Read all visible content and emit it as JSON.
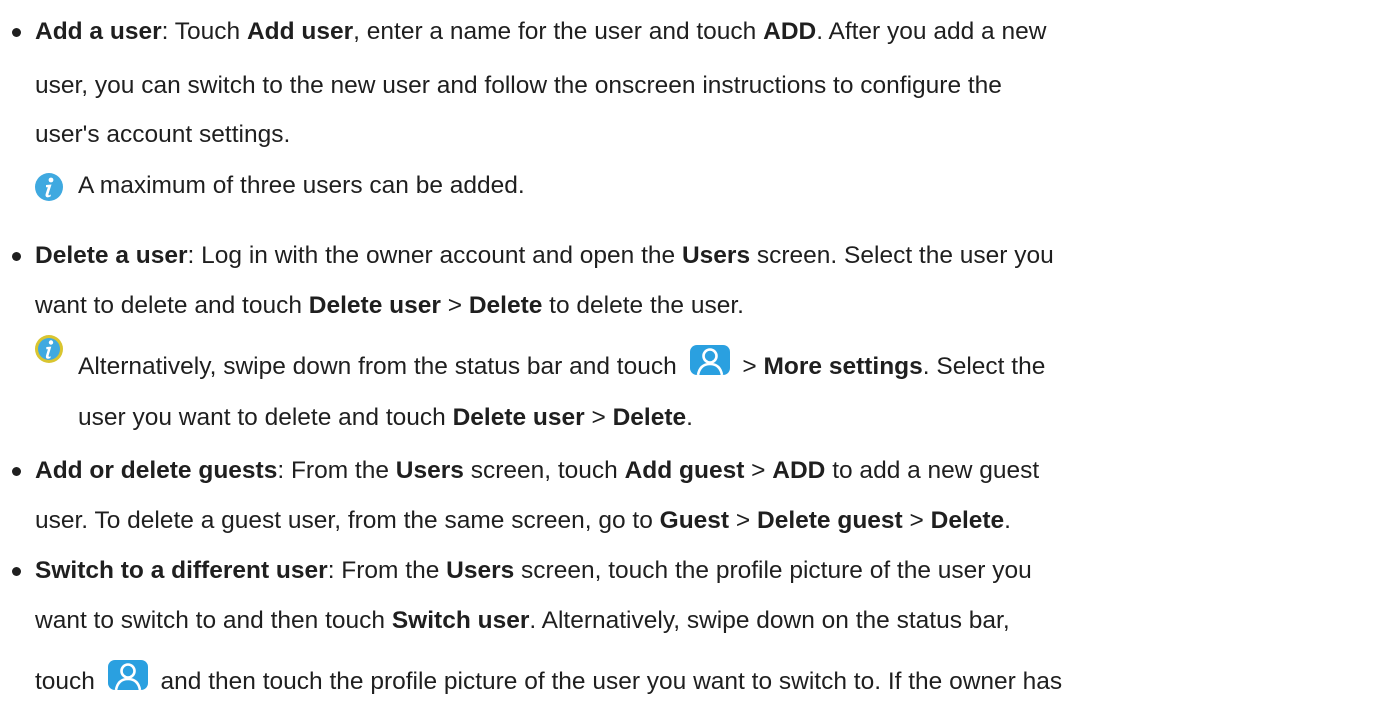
{
  "items": [
    {
      "title": "Add a user",
      "l1": [
        ": Touch ",
        "Add user",
        ", enter a name for the user and touch ",
        "ADD",
        ". After you add a new"
      ],
      "l2": "user, you can switch to the new user and follow the onscreen instructions to configure the",
      "l3": "user's account settings.",
      "note": "A maximum of three users can be added."
    },
    {
      "title": "Delete a user",
      "l1": [
        ": Log in with the owner account and open the ",
        "Users",
        " screen. Select the user you"
      ],
      "l2": [
        "want to delete and touch ",
        "Delete user",
        " > ",
        "Delete",
        " to delete the user."
      ],
      "note1": [
        "Alternatively, swipe down from the status bar and touch ",
        " > ",
        "More settings",
        ". Select the"
      ],
      "note2": [
        "user you want to delete and touch ",
        "Delete user",
        " > ",
        "Delete",
        "."
      ]
    },
    {
      "title": "Add or delete guests",
      "l1": [
        ": From the ",
        "Users",
        " screen, touch ",
        "Add guest",
        " > ",
        "ADD",
        " to add a new guest"
      ],
      "l2": [
        "user. To delete a guest user, from the same screen, go to ",
        "Guest",
        " > ",
        "Delete guest",
        " > ",
        "Delete",
        "."
      ]
    },
    {
      "title": "Switch to a different user",
      "l1": [
        ": From the ",
        "Users",
        " screen, touch the profile picture of the user you"
      ],
      "l2": [
        "want to switch to and then touch ",
        "Switch user",
        ". Alternatively, swipe down on the status bar,"
      ],
      "l3": [
        "touch ",
        " and then touch the profile picture of the user you want to switch to. If the owner has"
      ]
    }
  ],
  "colors": {
    "info_icon": "#3fa9e0",
    "info_icon_yellow": "#d9c530",
    "user_icon": "#2aa0e0"
  },
  "icons": {
    "info": "info-icon",
    "user": "user-profile-icon"
  }
}
